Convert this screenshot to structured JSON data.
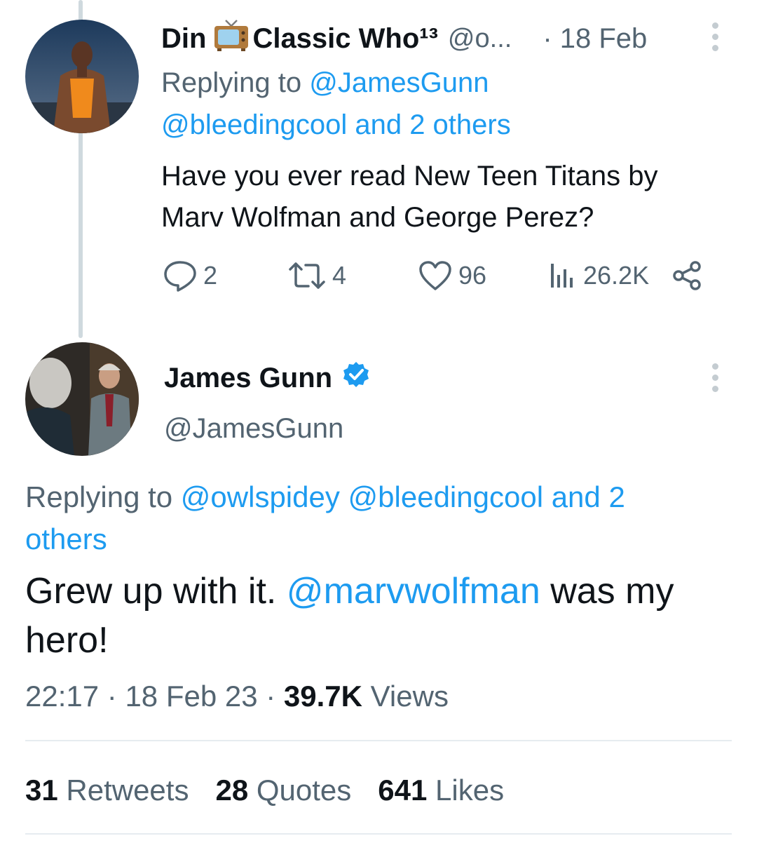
{
  "reply_tweet": {
    "display_name_part1": "Din",
    "display_name_part2": "Classic Who¹³",
    "handle": "@o...",
    "date": "· 18 Feb",
    "replying_prefix": "Replying to ",
    "replying_mention1": "@JamesGunn",
    "replying_line2": "@bleedingcool and 2 others",
    "text_line1": "Have you ever read New Teen Titans by",
    "text_line2": "Marv Wolfman and George Perez?",
    "actions": {
      "replies": "2",
      "retweets": "4",
      "likes": "96",
      "views": "26.2K"
    },
    "icons": [
      "tv-icon",
      "reply-icon",
      "retweet-icon",
      "like-icon",
      "views-icon",
      "share-icon",
      "more-icon"
    ]
  },
  "main_tweet": {
    "display_name": "James Gunn",
    "handle": "@JamesGunn",
    "verified": true,
    "replying_prefix": "Replying to ",
    "replying_mention1": "@owlspidey",
    "replying_mention2": "@bleedingcool and 2",
    "replying_line2": "others",
    "text_part1": "Grew up with it. ",
    "text_mention": "@marvwolfman",
    "text_part2": " was my",
    "text_line2": "hero!",
    "time": "22:17",
    "sep1": " · ",
    "date": "18 Feb 23",
    "sep2": " · ",
    "views_count": "39.7K",
    "views_label": " Views",
    "stats": {
      "retweets_count": "31",
      "retweets_label": " Retweets",
      "quotes_count": "28",
      "quotes_label": " Quotes",
      "likes_count": "641",
      "likes_label": " Likes"
    }
  },
  "colors": {
    "accent": "#1d9bf0",
    "muted": "#536471",
    "text": "#0f1419",
    "verified": "#1d9bf0",
    "divider": "#e6ecf0"
  }
}
